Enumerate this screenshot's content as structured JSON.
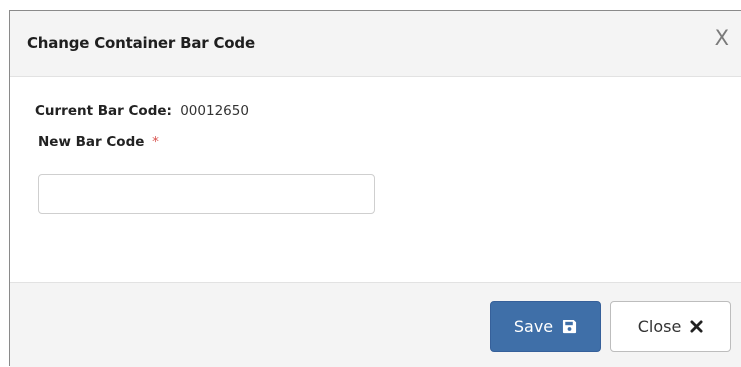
{
  "modal": {
    "title": "Change Container Bar Code",
    "close_glyph": "X",
    "current_label": "Current Bar Code:",
    "current_value": "00012650",
    "new_label": "New Bar Code",
    "required_mark": "*",
    "new_value": "",
    "save_label": "Save",
    "save_icon": "floppy-disk-icon",
    "close_label": "Close",
    "close_icon": "times-icon"
  },
  "colors": {
    "primary": "#3f6fa8",
    "required": "#d9534f",
    "header_bg": "#f4f4f4"
  }
}
